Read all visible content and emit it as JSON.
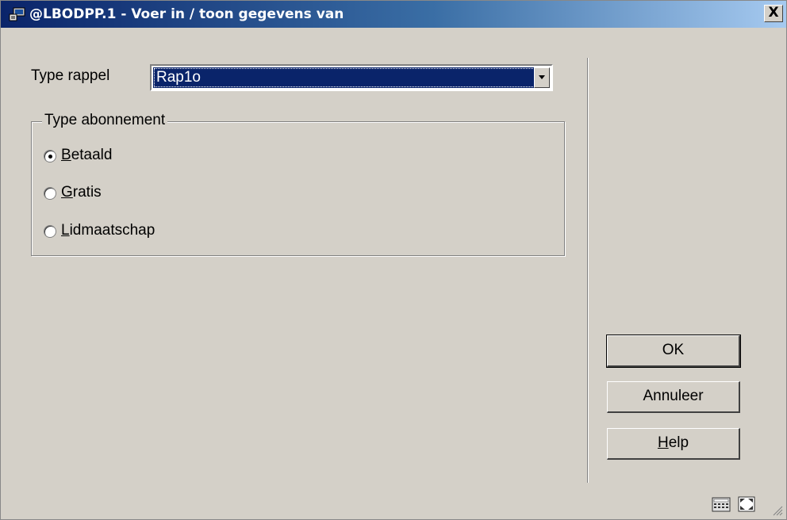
{
  "window": {
    "title": "@LBODPP.1 - Voer in / toon gegevens van",
    "close_glyph": "X",
    "bg_color": "#d4d0c8",
    "title_color": "#0a246a"
  },
  "form": {
    "type_rappel_label": "Type rappel",
    "type_rappel_value": "Rap1o",
    "groupbox_title": "Type abonnement",
    "radios": [
      {
        "mnemonic": "B",
        "rest": "etaald",
        "checked": true
      },
      {
        "mnemonic": "G",
        "rest": "ratis",
        "checked": false
      },
      {
        "mnemonic": "L",
        "rest": "idmaatschap",
        "checked": false
      }
    ]
  },
  "buttons": {
    "ok": "OK",
    "cancel": "Annuleer",
    "help_mnemonic": "H",
    "help_rest": "elp"
  },
  "status": {
    "icons": [
      "calculator-icon",
      "maximize-icon"
    ]
  }
}
